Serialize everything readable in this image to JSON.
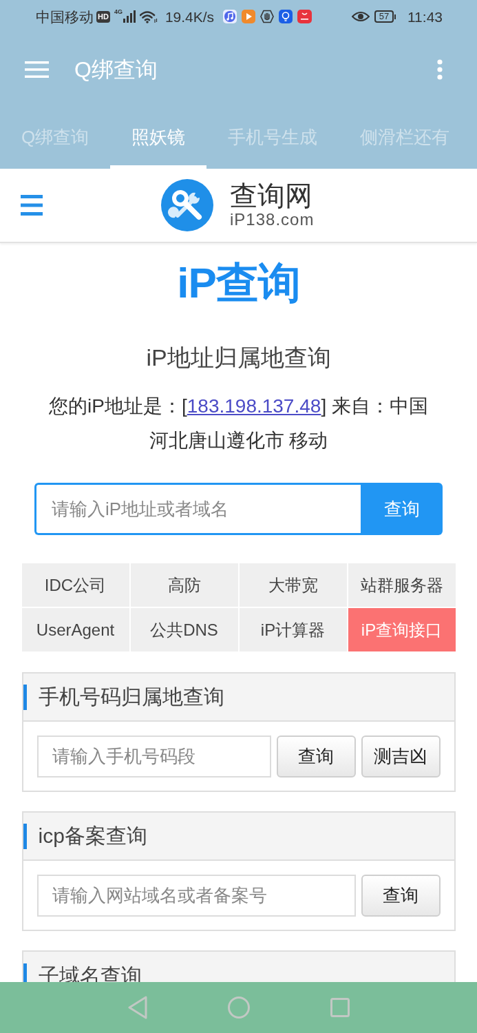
{
  "status_bar": {
    "carrier": "中国移动",
    "hd_badge": "HD",
    "network_type": "4G",
    "speed": "19.4K/s",
    "battery": "57",
    "time": "11:43"
  },
  "app_bar": {
    "title": "Q绑查询"
  },
  "tabs": [
    {
      "label": "Q绑查询",
      "selected": false
    },
    {
      "label": "照妖镜",
      "selected": true
    },
    {
      "label": "手机号生成",
      "selected": false
    },
    {
      "label": "侧滑栏还有",
      "selected": false
    }
  ],
  "site_header": {
    "name": "查询网",
    "domain": "iP138.com"
  },
  "ip_lookup": {
    "logo": "iP查询",
    "heading": "iP地址归属地查询",
    "result_prefix": "您的iP地址是：[",
    "ip_address": "183.198.137.48",
    "result_suffix": "] 来自：中国河北唐山遵化市 移动",
    "search": {
      "placeholder": "请输入iP地址或者域名",
      "button": "查询"
    }
  },
  "quick_links": [
    {
      "label": "IDC公司",
      "highlighted": false
    },
    {
      "label": "高防",
      "highlighted": false
    },
    {
      "label": "大带宽",
      "highlighted": false
    },
    {
      "label": "站群服务器",
      "highlighted": false
    },
    {
      "label": "UserAgent",
      "highlighted": false
    },
    {
      "label": "公共DNS",
      "highlighted": false
    },
    {
      "label": "iP计算器",
      "highlighted": false
    },
    {
      "label": "iP查询接口",
      "highlighted": true
    }
  ],
  "panels": [
    {
      "title": "手机号码归属地查询",
      "placeholder": "请输入手机号码段",
      "buttons": [
        "查询",
        "测吉凶"
      ]
    },
    {
      "title": "icp备案查询",
      "placeholder": "请输入网站域名或者备案号",
      "buttons": [
        "查询"
      ]
    },
    {
      "title": "子域名查询"
    }
  ]
}
